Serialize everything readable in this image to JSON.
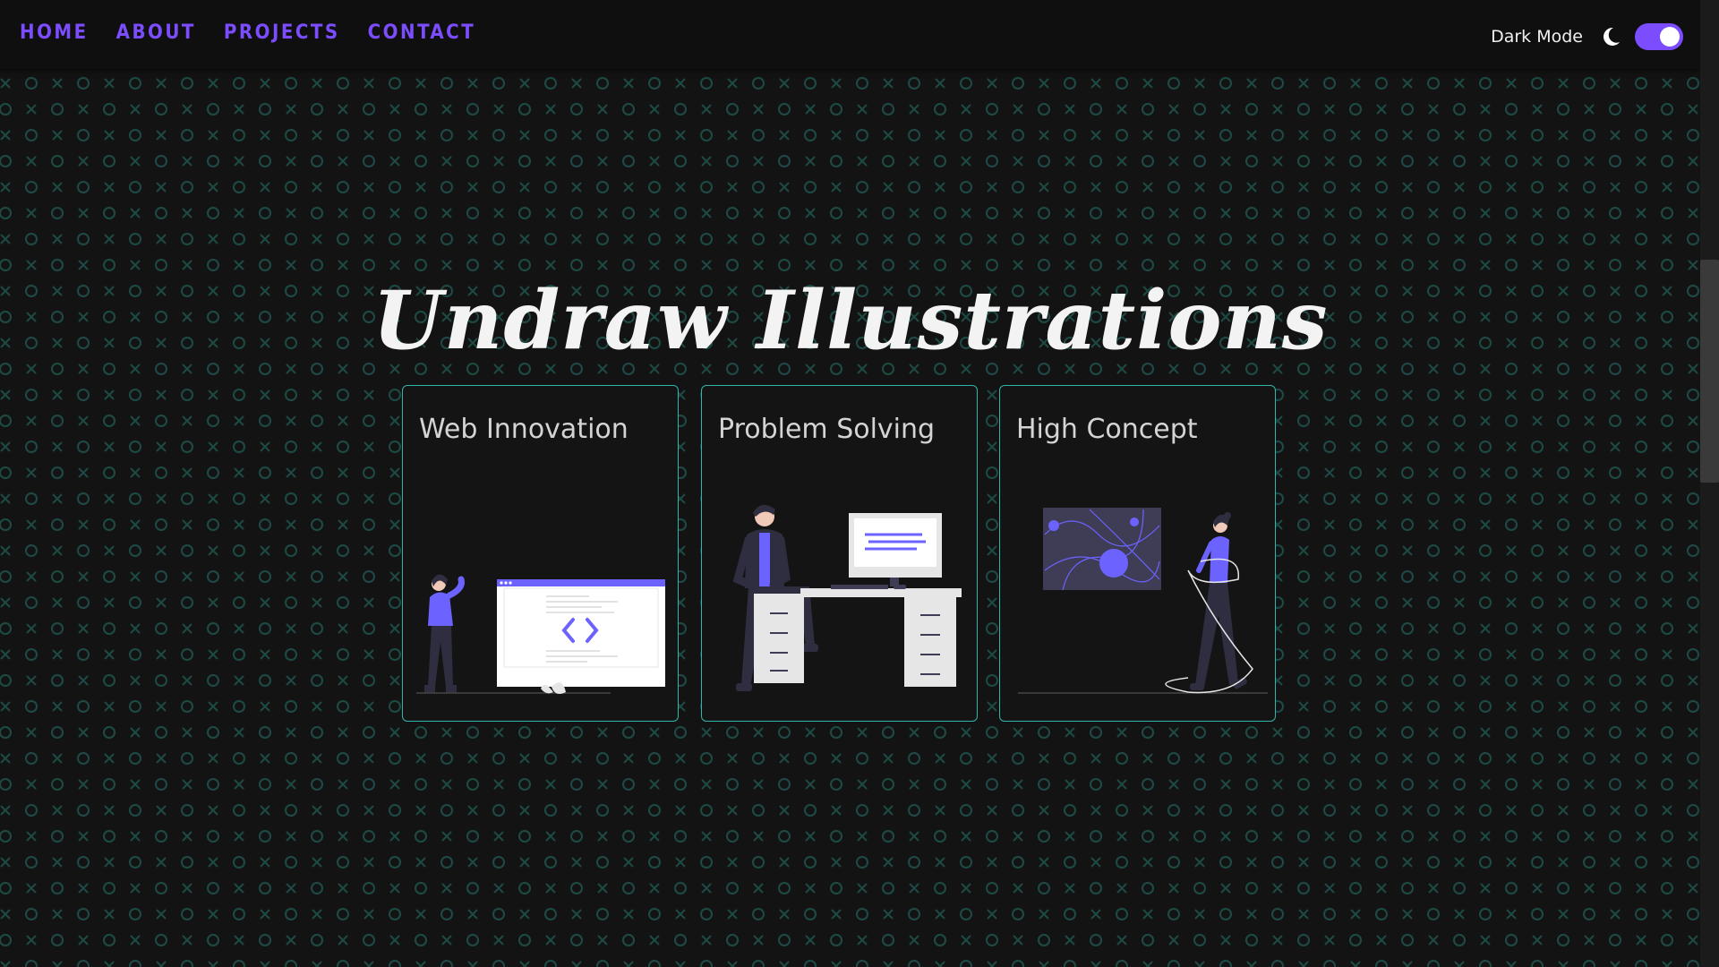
{
  "nav": {
    "links": [
      {
        "label": "HOME"
      },
      {
        "label": "ABOUT"
      },
      {
        "label": "PROJECTS"
      },
      {
        "label": "CONTACT"
      }
    ],
    "dark_mode_label": "Dark Mode",
    "dark_mode_on": true
  },
  "hero": {
    "title": "Undraw Illustrations"
  },
  "cards": [
    {
      "title": "Web Innovation",
      "illustration": "developer-code-window"
    },
    {
      "title": "Problem Solving",
      "illustration": "person-at-desk"
    },
    {
      "title": "High Concept",
      "illustration": "abstract-art-woman-walking"
    }
  ],
  "colors": {
    "background": "#131313",
    "accent": "#7c4dff",
    "card_border": "#2fb5ad",
    "pattern": "#1e4a46",
    "illustration_purple": "#6c63ff"
  }
}
